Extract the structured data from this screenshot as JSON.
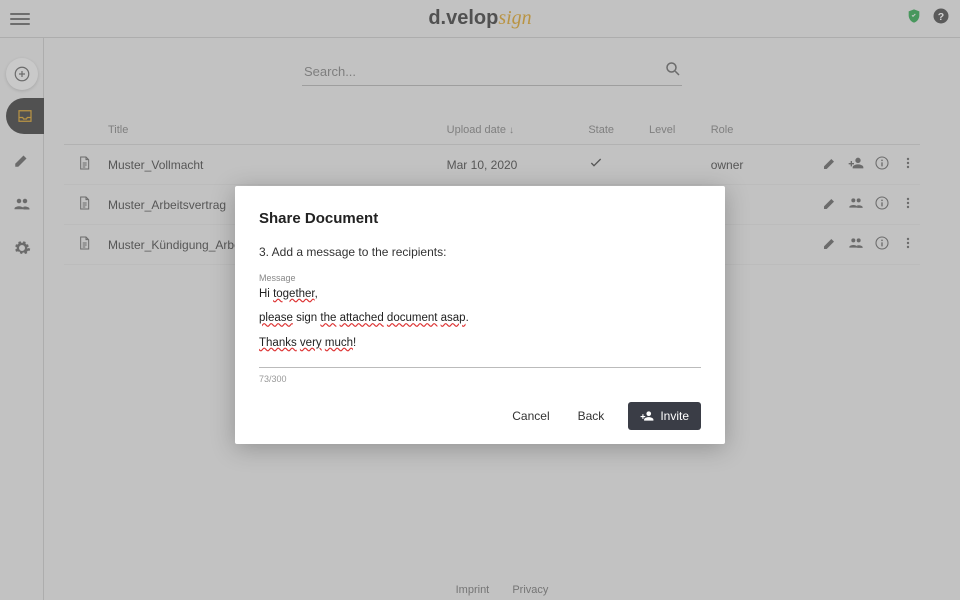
{
  "header": {
    "logo_a": "d.velop",
    "logo_b": "sign"
  },
  "search": {
    "placeholder": "Search..."
  },
  "table": {
    "headers": {
      "title": "Title",
      "upload": "Upload date",
      "state": "State",
      "level": "Level",
      "role": "Role"
    },
    "rows": [
      {
        "title": "Muster_Vollmacht",
        "date": "Mar 10, 2020",
        "role": "owner",
        "state": "check",
        "share": "person-add"
      },
      {
        "title": "Muster_Arbeitsvertrag",
        "date": "",
        "role": "",
        "state": "",
        "share": "group"
      },
      {
        "title": "Muster_Kündigung_Arbeitsverh…",
        "date": "",
        "role": "",
        "state": "",
        "share": "group"
      }
    ]
  },
  "modal": {
    "title": "Share Document",
    "step": "3. Add a message to the recipients:",
    "msg_label": "Message",
    "msg_line1_a": "Hi ",
    "msg_line1_b": "together",
    "msg_line1_c": ",",
    "msg_line2_a": "please",
    "msg_line2_b": " sign ",
    "msg_line2_c": "the",
    "msg_line2_d": " ",
    "msg_line2_e": "attached",
    "msg_line2_f": " ",
    "msg_line2_g": "document",
    "msg_line2_h": " ",
    "msg_line2_i": "asap",
    "msg_line2_j": ".",
    "msg_line3_a": "Thanks",
    "msg_line3_b": " ",
    "msg_line3_c": "very",
    "msg_line3_d": " ",
    "msg_line3_e": "much",
    "msg_line3_f": "!",
    "counter": "73/300",
    "cancel": "Cancel",
    "back": "Back",
    "invite": "Invite"
  },
  "footer": {
    "imprint": "Imprint",
    "privacy": "Privacy"
  }
}
